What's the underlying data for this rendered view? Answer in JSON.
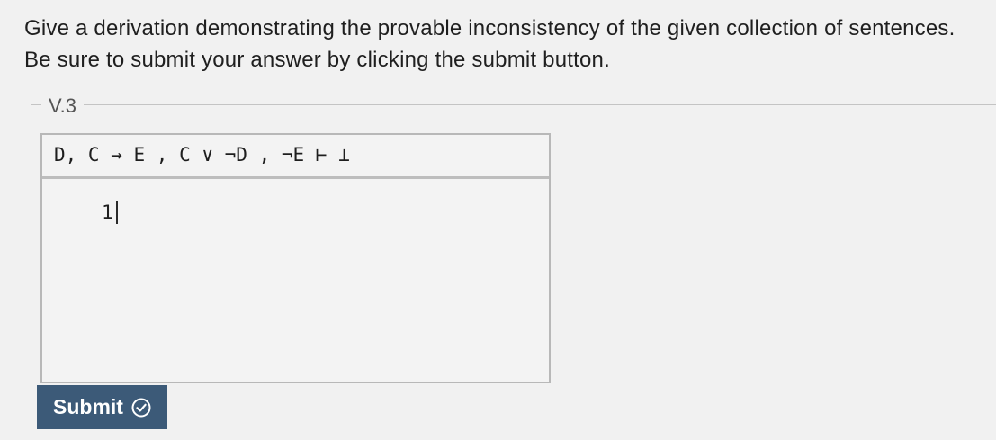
{
  "instructions": {
    "text": "Give a derivation demonstrating the provable inconsistency of the given collection of sentences. Be sure to submit your answer by clicking the submit button."
  },
  "problem": {
    "legend": "V.3",
    "sequent": "D, C → E , C ∨ ¬D , ¬E ⊢ ⊥",
    "lines": [
      {
        "number": "1",
        "content": ""
      }
    ]
  },
  "submit": {
    "label": "Submit",
    "icon": "check-circle-icon"
  },
  "colors": {
    "background": "#f1f1f1",
    "submit_background": "#3c5a78",
    "submit_text": "#ffffff",
    "box_border": "#b8b8b8"
  }
}
